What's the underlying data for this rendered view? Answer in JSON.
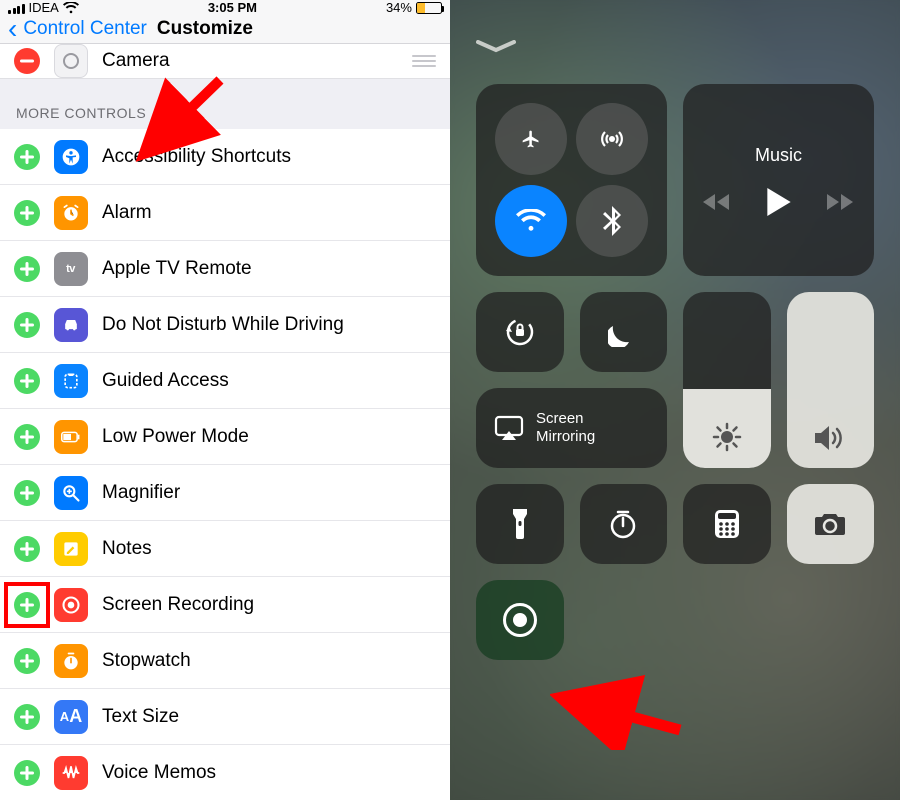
{
  "status": {
    "carrier": "IDEA",
    "time": "3:05 PM",
    "battery_pct": "34%"
  },
  "nav": {
    "back_label": "Control Center",
    "title": "Customize"
  },
  "current": {
    "camera_label": "Camera"
  },
  "section": {
    "more_controls": "MORE CONTROLS"
  },
  "controls": {
    "items": [
      {
        "label": "Accessibility Shortcuts",
        "icon": "accessibility-icon",
        "color": "ic-blue"
      },
      {
        "label": "Alarm",
        "icon": "alarm-icon",
        "color": "ic-orange"
      },
      {
        "label": "Apple TV Remote",
        "icon": "appletv-icon",
        "color": "ic-gray"
      },
      {
        "label": "Do Not Disturb While Driving",
        "icon": "car-icon",
        "color": "ic-purple"
      },
      {
        "label": "Guided Access",
        "icon": "guided-icon",
        "color": "ic-blue2"
      },
      {
        "label": "Low Power Mode",
        "icon": "lowpower-icon",
        "color": "ic-orange"
      },
      {
        "label": "Magnifier",
        "icon": "magnifier-icon",
        "color": "ic-blue"
      },
      {
        "label": "Notes",
        "icon": "notes-icon",
        "color": "ic-yellow"
      },
      {
        "label": "Screen Recording",
        "icon": "record-icon",
        "color": "ic-red"
      },
      {
        "label": "Stopwatch",
        "icon": "stopwatch-icon",
        "color": "ic-orange"
      },
      {
        "label": "Text Size",
        "icon": "textsize-icon",
        "color": "ic-blueA"
      },
      {
        "label": "Voice Memos",
        "icon": "voice-icon",
        "color": "ic-red"
      }
    ]
  },
  "cc": {
    "music_label": "Music",
    "mirror_label": "Screen\nMirroring"
  },
  "annotations": {
    "highlight_row_index": 8,
    "arrow1_target": "more-controls-header",
    "arrow2_target": "record-tile"
  }
}
